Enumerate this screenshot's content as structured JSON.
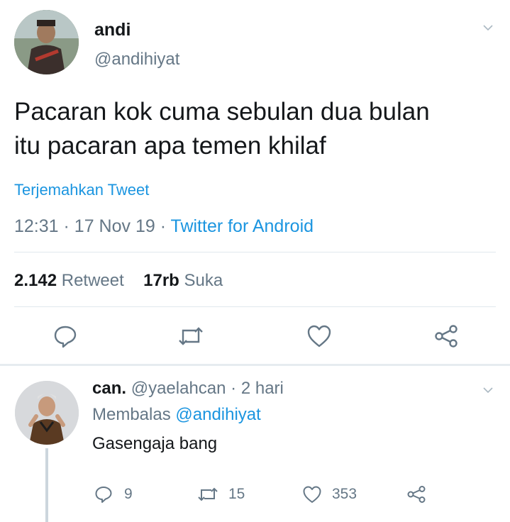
{
  "tweet": {
    "author_name": "andi",
    "author_handle": "@andihiyat",
    "text_line1": "Pacaran kok cuma sebulan dua bulan",
    "text_line2": "itu pacaran apa temen khilaf",
    "translate_label": "Terjemahkan Tweet",
    "time": "12:31",
    "date": "17 Nov 19",
    "source": "Twitter for Android",
    "separator": "·",
    "retweet_count": "2.142",
    "retweet_label": "Retweet",
    "like_count": "17rb",
    "like_label": "Suka"
  },
  "reply": {
    "author_name": "can.",
    "author_handle": "@yaelahcan",
    "separator": "·",
    "time_ago": "2 hari",
    "replying_prefix": "Membalas",
    "replying_to": "@andihiyat",
    "text": "Gasengaja bang",
    "reply_count": "9",
    "retweet_count": "15",
    "like_count": "353"
  },
  "colors": {
    "accent": "#1b95e0",
    "muted": "#657786",
    "divider": "#e1e8ed",
    "text": "#14171a"
  },
  "icons": {
    "reply": "reply-icon",
    "retweet": "retweet-icon",
    "like": "heart-icon",
    "share": "share-icon",
    "menu": "chevron-down-icon"
  }
}
